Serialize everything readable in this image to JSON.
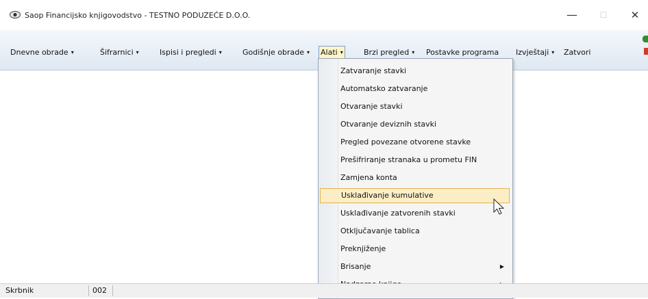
{
  "window": {
    "title": "Saop Financijsko knjigovodstvo - TESTNO PODUZEĆE D.O.O.",
    "icon": "eye-icon",
    "minimize_glyph": "—",
    "maximize_glyph": "☐",
    "close_glyph": "✕"
  },
  "menubar": {
    "items": [
      {
        "label": "Dnevne obrade",
        "caret": "▾"
      },
      {
        "label": "Šifrarnici",
        "caret": "▾"
      },
      {
        "label": "Ispisi i pregledi",
        "caret": "▾"
      },
      {
        "label": "Godišnje obrade",
        "caret": "▾"
      },
      {
        "label": "Alati",
        "caret": "▾"
      },
      {
        "label": "Brzi pregled",
        "caret": "▾"
      },
      {
        "label": "Postavke programa",
        "caret": ""
      },
      {
        "label": "Izvještaji",
        "caret": "▾"
      },
      {
        "label": "Zatvori",
        "caret": ""
      }
    ]
  },
  "dropdown": {
    "items": [
      {
        "label": "Zatvaranje stavki"
      },
      {
        "label": "Automatsko zatvaranje"
      },
      {
        "label": "Otvaranje stavki"
      },
      {
        "label": "Otvaranje deviznih stavki"
      },
      {
        "label": "Pregled povezane otvorene stavke"
      },
      {
        "label": "Prešifriranje stranaka u prometu FIN"
      },
      {
        "label": "Zamjena konta"
      },
      {
        "label": "Usklađivanje kumulative"
      },
      {
        "label": "Usklađivanje zatvorenih stavki"
      },
      {
        "label": "Otključavanje tablica"
      },
      {
        "label": "Preknjiženje"
      },
      {
        "label": "Brisanje",
        "arrow": "▶"
      },
      {
        "label": "Nadzorne knjige",
        "arrow": "▶"
      }
    ],
    "highlighted_index": 7
  },
  "statusbar": {
    "user": "Skrbnik",
    "code": "002"
  },
  "colors": {
    "menu_highlight": "#fbeec6",
    "menu_highlight_border": "#e4b34c",
    "menubar_bg": "#dfe8f2"
  }
}
